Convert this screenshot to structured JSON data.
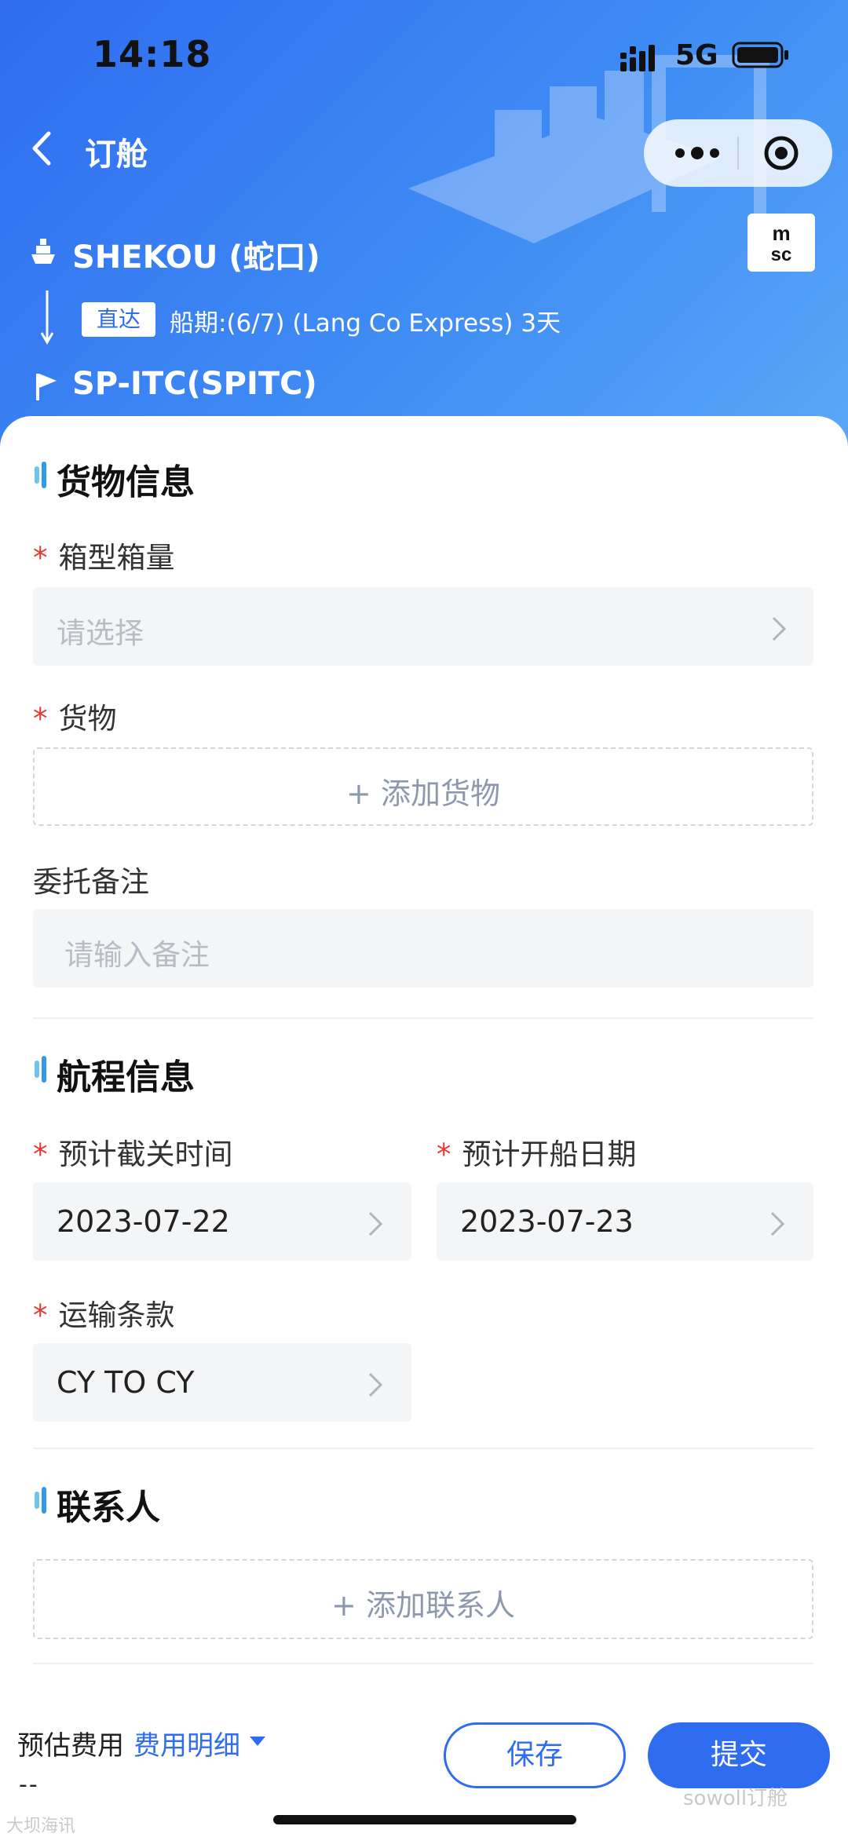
{
  "status_bar": {
    "time": "14:18",
    "network": "5G"
  },
  "nav": {
    "title": "订舱"
  },
  "route": {
    "origin": "SHEKOU (蛇口)",
    "badge": "直达",
    "schedule": "船期:(6/7) (Lang Co Express) 3天",
    "destination": "SP-ITC(SPITC)",
    "carrier_logo_text": "msc"
  },
  "cargo_section": {
    "title": "货物信息",
    "required_mark": "*",
    "container_label": "箱型箱量",
    "container_placeholder": "请选择",
    "cargo_label": "货物",
    "add_cargo": "+ 添加货物",
    "remark_label": "委托备注",
    "remark_placeholder": "请输入备注"
  },
  "voyage_section": {
    "title": "航程信息",
    "cutoff_label": "预计截关时间",
    "cutoff_value": "2023-07-22",
    "departure_label": "预计开船日期",
    "departure_value": "2023-07-23",
    "terms_label": "运输条款",
    "terms_value": "CY TO CY"
  },
  "contact_section": {
    "title": "联系人",
    "add_contact": "+ 添加联系人"
  },
  "footer": {
    "estimate_label": "预估费用",
    "estimate_link": "费用明细",
    "estimate_value": "--",
    "save_label": "保存",
    "submit_label": "提交"
  },
  "watermarks": {
    "left": "大坝海讯",
    "right": "sowoll订舱"
  },
  "colors": {
    "primary": "#2f6cf0",
    "required": "#e53935",
    "field_bg": "#f4f5f7"
  },
  "icons": [
    "back-arrow-icon",
    "more-dots-icon",
    "target-icon",
    "ship-icon",
    "arrow-down-icon",
    "flag-icon",
    "chevron-right-icon",
    "caret-down-icon",
    "signal-icon",
    "battery-icon"
  ]
}
